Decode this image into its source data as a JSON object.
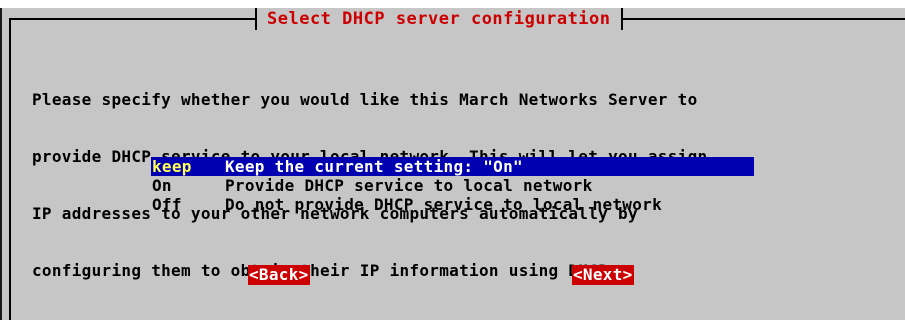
{
  "dialog": {
    "title": "Select DHCP server configuration",
    "body_lines": [
      "Please specify whether you would like this March Networks Server to",
      "provide DHCP service to your local network. This will let you assign",
      "IP addresses to your other network computers automatically by",
      "configuring them to obtain their IP information using DHCP."
    ],
    "menu": [
      {
        "tag": "keep",
        "label": "Keep the current setting: \"On\"",
        "selected": true
      },
      {
        "tag": "On",
        "label": "Provide DHCP service to local network",
        "selected": false
      },
      {
        "tag": "Off",
        "label": "Do not provide DHCP service to local network",
        "selected": false
      }
    ],
    "buttons": {
      "back": "<Back>",
      "next": "<Next>"
    }
  },
  "colors": {
    "dialog_bg": "#c6c6c6",
    "title_fg": "#cc0000",
    "selection_bg": "#0000b0",
    "selection_tag_fg": "#ffff55",
    "button_bg": "#cc0000",
    "button_fg": "#ffffff"
  }
}
